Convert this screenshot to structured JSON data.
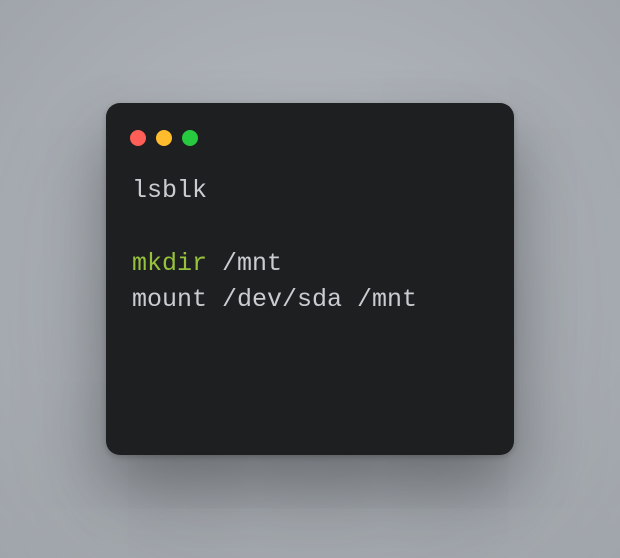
{
  "window": {
    "traffic_lights": {
      "close": "close",
      "minimize": "minimize",
      "zoom": "zoom"
    }
  },
  "terminal": {
    "lines": {
      "l1": "lsblk",
      "blank": " ",
      "l2_cmd": "mkdir",
      "l2_arg": " /mnt",
      "l3": "mount /dev/sda /mnt"
    }
  }
}
